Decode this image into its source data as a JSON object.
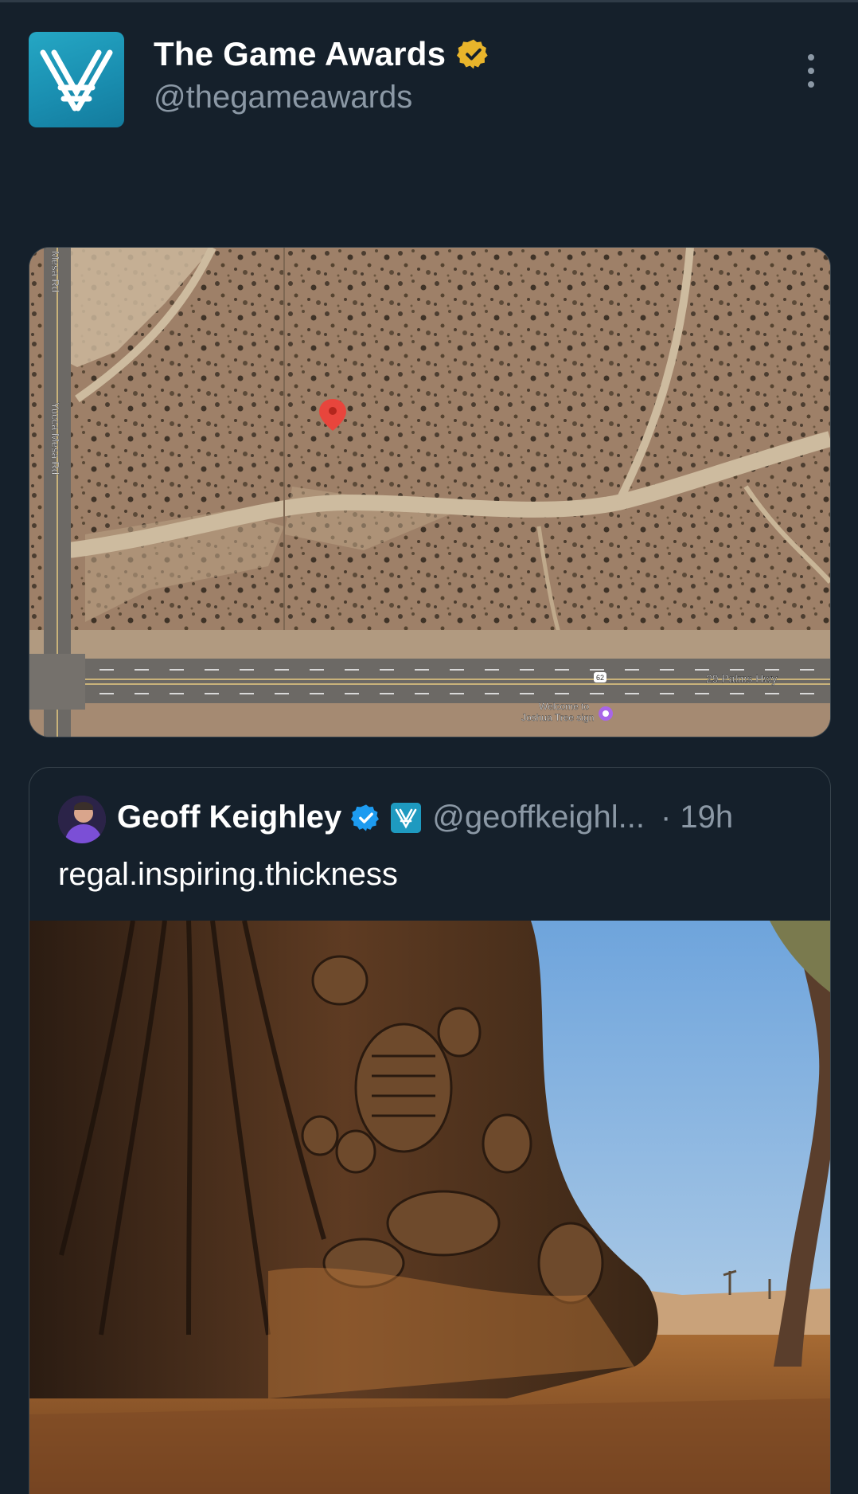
{
  "tweet": {
    "display_name": "The Game Awards",
    "handle": "@thegameawards",
    "verified_badge": "gold-verified-icon",
    "menu_icon": "more-options-icon"
  },
  "map": {
    "road_vertical_1": "Mesa Rd",
    "road_vertical_2": "Yucca Mesa Rd",
    "highway": "29 Palms Hwy",
    "highway_shield": "62",
    "poi_label_1": "Welcome to",
    "poi_label_2": "Joshua Tree sign",
    "pin_color": "#e8453c"
  },
  "quoted_tweet": {
    "display_name": "Geoff Keighley",
    "handle": "@geoffkeighl...",
    "time": "· 19h",
    "text": "regal.inspiring.thickness",
    "media_description": "carved-sculpture-desert-photo"
  },
  "colors": {
    "background": "#15202b",
    "secondary_text": "#8b98a5",
    "verified_blue": "#1d9bf0",
    "verified_gold": "#e8b42b",
    "brand_teal": "#1e9ac0"
  }
}
